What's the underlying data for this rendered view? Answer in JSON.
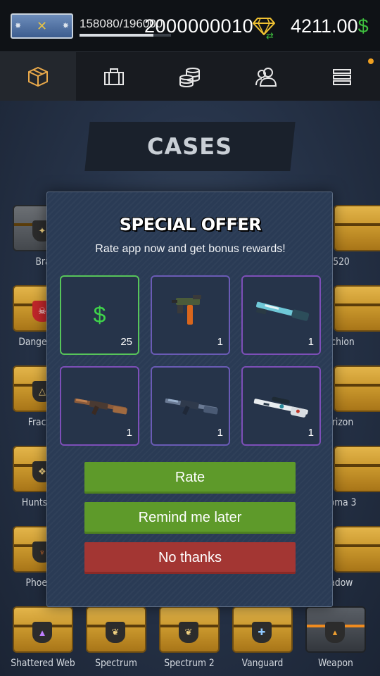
{
  "topbar": {
    "xp": "158080/196000",
    "xp_progress": 0.81,
    "gems": "2000000010",
    "money_amount": "4211.00",
    "money_symbol": "$",
    "icons": [
      "rank-badge",
      "diamond-icon",
      "swap-icon"
    ]
  },
  "nav": {
    "items": [
      {
        "name": "cases",
        "icon": "package-icon",
        "active": true
      },
      {
        "name": "inventory",
        "icon": "briefcase-icon",
        "active": false
      },
      {
        "name": "coins",
        "icon": "coins-icon",
        "active": false
      },
      {
        "name": "friends",
        "icon": "users-icon",
        "active": false
      },
      {
        "name": "menu",
        "icon": "menu-icon",
        "active": false
      }
    ]
  },
  "page": {
    "title": "CASES"
  },
  "cases": [
    {
      "label": "Bra"
    },
    {
      "label": "520"
    },
    {
      "label": "Danger"
    },
    {
      "label": "chion"
    },
    {
      "label": "Fract"
    },
    {
      "label": "rizon"
    },
    {
      "label": "Hunts"
    },
    {
      "label": "oma 3"
    },
    {
      "label": "Phoenix"
    },
    {
      "label": "Shadow"
    },
    {
      "label": "Shattered Web"
    },
    {
      "label": "Spectrum"
    },
    {
      "label": "Spectrum 2"
    },
    {
      "label": "Vanguard"
    },
    {
      "label": "Weapon"
    }
  ],
  "modal": {
    "title": "SPECIAL OFFER",
    "subtitle": "Rate app now and get bonus rewards!",
    "rewards": [
      {
        "type": "cash",
        "icon": "dollar-icon",
        "count": "25"
      },
      {
        "type": "smg-skin",
        "icon": "smg-icon",
        "count": "1"
      },
      {
        "type": "shotgun-skin",
        "icon": "shotgun-icon",
        "count": "1"
      },
      {
        "type": "rifle-skin",
        "icon": "ak-rifle-icon",
        "count": "1"
      },
      {
        "type": "rifle-skin",
        "icon": "rifle-icon",
        "count": "1"
      },
      {
        "type": "sniper-skin",
        "icon": "sniper-icon",
        "count": "1"
      }
    ],
    "buttons": {
      "rate": "Rate",
      "remind": "Remind me later",
      "no": "No thanks"
    },
    "colors": {
      "cash_border": "#57c45a",
      "rate_green": "#5e9a2a",
      "no_red": "#a33633"
    }
  }
}
